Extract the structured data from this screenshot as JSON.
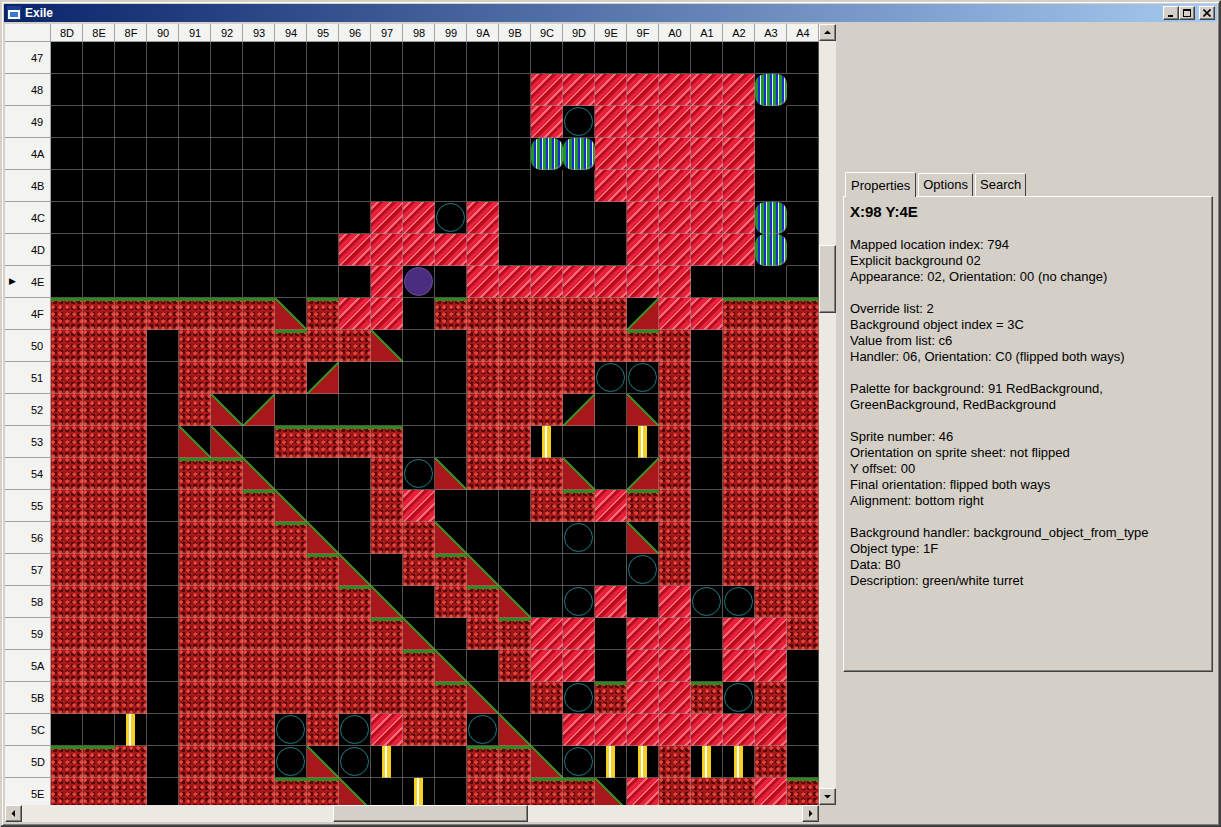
{
  "window": {
    "title": "Exile"
  },
  "map": {
    "columns": [
      "8D",
      "8E",
      "8F",
      "90",
      "91",
      "92",
      "93",
      "94",
      "95",
      "96",
      "97",
      "98",
      "99",
      "9A",
      "9B",
      "9C",
      "9D",
      "9E",
      "9F",
      "A0",
      "A1",
      "A2",
      "A3",
      "A4"
    ],
    "row_marker": "▶",
    "selected_cell": {
      "column": "98",
      "row": "4E"
    },
    "rows": [
      {
        "label": "47",
        "selected": false,
        "tiles": "........................"
      },
      {
        "label": "48",
        "selected": false,
        "tiles": "...............SSSSSSSG."
      },
      {
        "label": "49",
        "selected": false,
        "tiles": "...............SoSSSSS.."
      },
      {
        "label": "4A",
        "selected": false,
        "tiles": "...............GGSSSSS.."
      },
      {
        "label": "4B",
        "selected": false,
        "tiles": ".................SSSSS.."
      },
      {
        "label": "4C",
        "selected": false,
        "tiles": "..........SSoS....SSSSG."
      },
      {
        "label": "4D",
        "selected": false,
        "tiles": ".........SSSSS....SSSSG."
      },
      {
        "label": "4E",
        "selected": true,
        "tiles": "..........So.SSSSSSS...."
      },
      {
        "label": "4F",
        "selected": false,
        "tiles": "RRRRRRRaRSS.RRRRRRbSSRRR"
      },
      {
        "label": "50",
        "selected": false,
        "tiles": "RRR.RRRRRRa..RRRRRRR.RRR"
      },
      {
        "label": "51",
        "selected": false,
        "tiles": "RRR.RRRRb....RRRRooR.RRR"
      },
      {
        "label": "52",
        "selected": false,
        "tiles": "RRR.Rab......RRRb.aR.RRR"
      },
      {
        "label": "53",
        "selected": false,
        "tiles": "RRR.aa.RRRR..RRY..YR.RRR"
      },
      {
        "label": "54",
        "selected": false,
        "tiles": "RRR.RRa...RoaRRRa.bR.RRR"
      },
      {
        "label": "55",
        "selected": false,
        "tiles": "RRR.RRRa..RS...RRSRR.RRR"
      },
      {
        "label": "56",
        "selected": false,
        "tiles": "RRR.RRRRa.RRa...o.aR.RRR"
      },
      {
        "label": "57",
        "selected": false,
        "tiles": "RRR.RRRRRa.RRa....oR.RRR"
      },
      {
        "label": "58",
        "selected": false,
        "tiles": "RRR.RRRRRRa.RRa.oS.SooRR"
      },
      {
        "label": "59",
        "selected": false,
        "tiles": "RRR.RRRRRRRa.RRSS.SS.SSR"
      },
      {
        "label": "5A",
        "selected": false,
        "tiles": "RRR.RRRRRRRRa.RSS.SS.SS."
      },
      {
        "label": "5B",
        "selected": false,
        "tiles": "RRR.RRRRRRRRRa.RoRSSRoR."
      },
      {
        "label": "5C",
        "selected": false,
        "tiles": "..Y.RRRoRoSRRoa.SSSSSSS."
      },
      {
        "label": "5D",
        "selected": false,
        "tiles": "RRR.RRRoaoY..RRaoYYRYYR."
      },
      {
        "label": "5E",
        "selected": false,
        "tiles": "RRR.RRRRRa.Y.RRRRaSRRRSR"
      }
    ],
    "scroll": {
      "vertical": {
        "level": 0.3
      },
      "horizontal": {
        "level": 0.53
      }
    }
  },
  "tabs": [
    {
      "label": "Properties",
      "selected": true
    },
    {
      "label": "Options",
      "selected": false
    },
    {
      "label": "Search",
      "selected": false
    }
  ],
  "properties": {
    "heading": "X:98 Y:4E",
    "groups": [
      [
        "Mapped location index: 794",
        "Explicit background 02",
        "Appearance: 02, Orientation: 00 (no change)"
      ],
      [
        "Override list: 2",
        "Background object index = 3C",
        "Value from list: c6",
        "Handler: 06, Orientation: C0 (flipped both ways)"
      ],
      [
        "Palette for background: 91 RedBackground,",
        "GreenBackground, RedBackground"
      ],
      [
        "Sprite number: 46",
        "Orientation on sprite sheet: not flipped",
        "Y offset: 00",
        "Final orientation: flipped both ways",
        "Alignment: bottom right"
      ],
      [
        "Background handler: background_object_from_type",
        "Object type: 1F",
        "Data: B0",
        "Description: green/white turret"
      ]
    ]
  }
}
